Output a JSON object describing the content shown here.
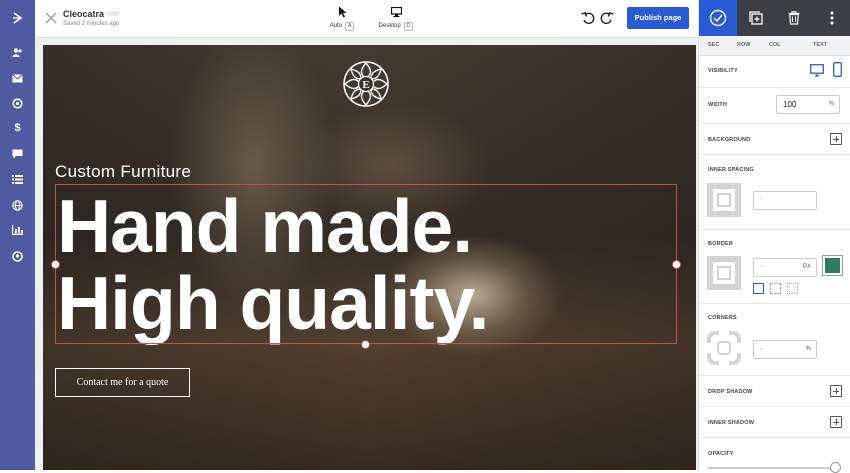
{
  "app": {
    "site_name": "Cleocatra",
    "save_status": "Saved 2 minutes ago",
    "publish_label": "Publish page"
  },
  "modes": {
    "auto": {
      "label": "Auto",
      "key": "A"
    },
    "desktop": {
      "label": "Desktop",
      "key": "D"
    }
  },
  "rail_icons": [
    "logo-icon",
    "contacts-icon",
    "mail-icon",
    "analytics-icon",
    "dollar-icon",
    "chat-icon",
    "list-icon",
    "globe-icon",
    "chart-icon",
    "pin-icon"
  ],
  "hero": {
    "subtitle": "Custom Furniture",
    "headline_line1": "Hand made.",
    "headline_line2": "High quality.",
    "cta_label": "Contact me for a quote"
  },
  "panel": {
    "breadcrumbs": [
      "SEC",
      "ROW",
      "COL",
      "TEXT"
    ],
    "visibility_label": "VISIBILITY",
    "width_label": "WIDTH",
    "width_value": "100",
    "width_unit": "%",
    "background_label": "BACKGROUND",
    "inner_spacing_label": "INNER SPACING",
    "inner_spacing_placeholder": "-",
    "border_label": "BORDER",
    "border_placeholder": "-",
    "border_unit": "PX",
    "border_color": "#2e7d5b",
    "corners_label": "CORNERS",
    "corners_placeholder": "-",
    "corners_unit": "%",
    "drop_shadow_label": "DROP SHADOW",
    "inner_shadow_label": "INNER SHADOW",
    "opacity_label": "OPACITY"
  },
  "colors": {
    "rail": "#4f5aa0",
    "accent": "#2a5bd7",
    "selection": "#c0544d",
    "panel_header": "#3d3d45"
  }
}
